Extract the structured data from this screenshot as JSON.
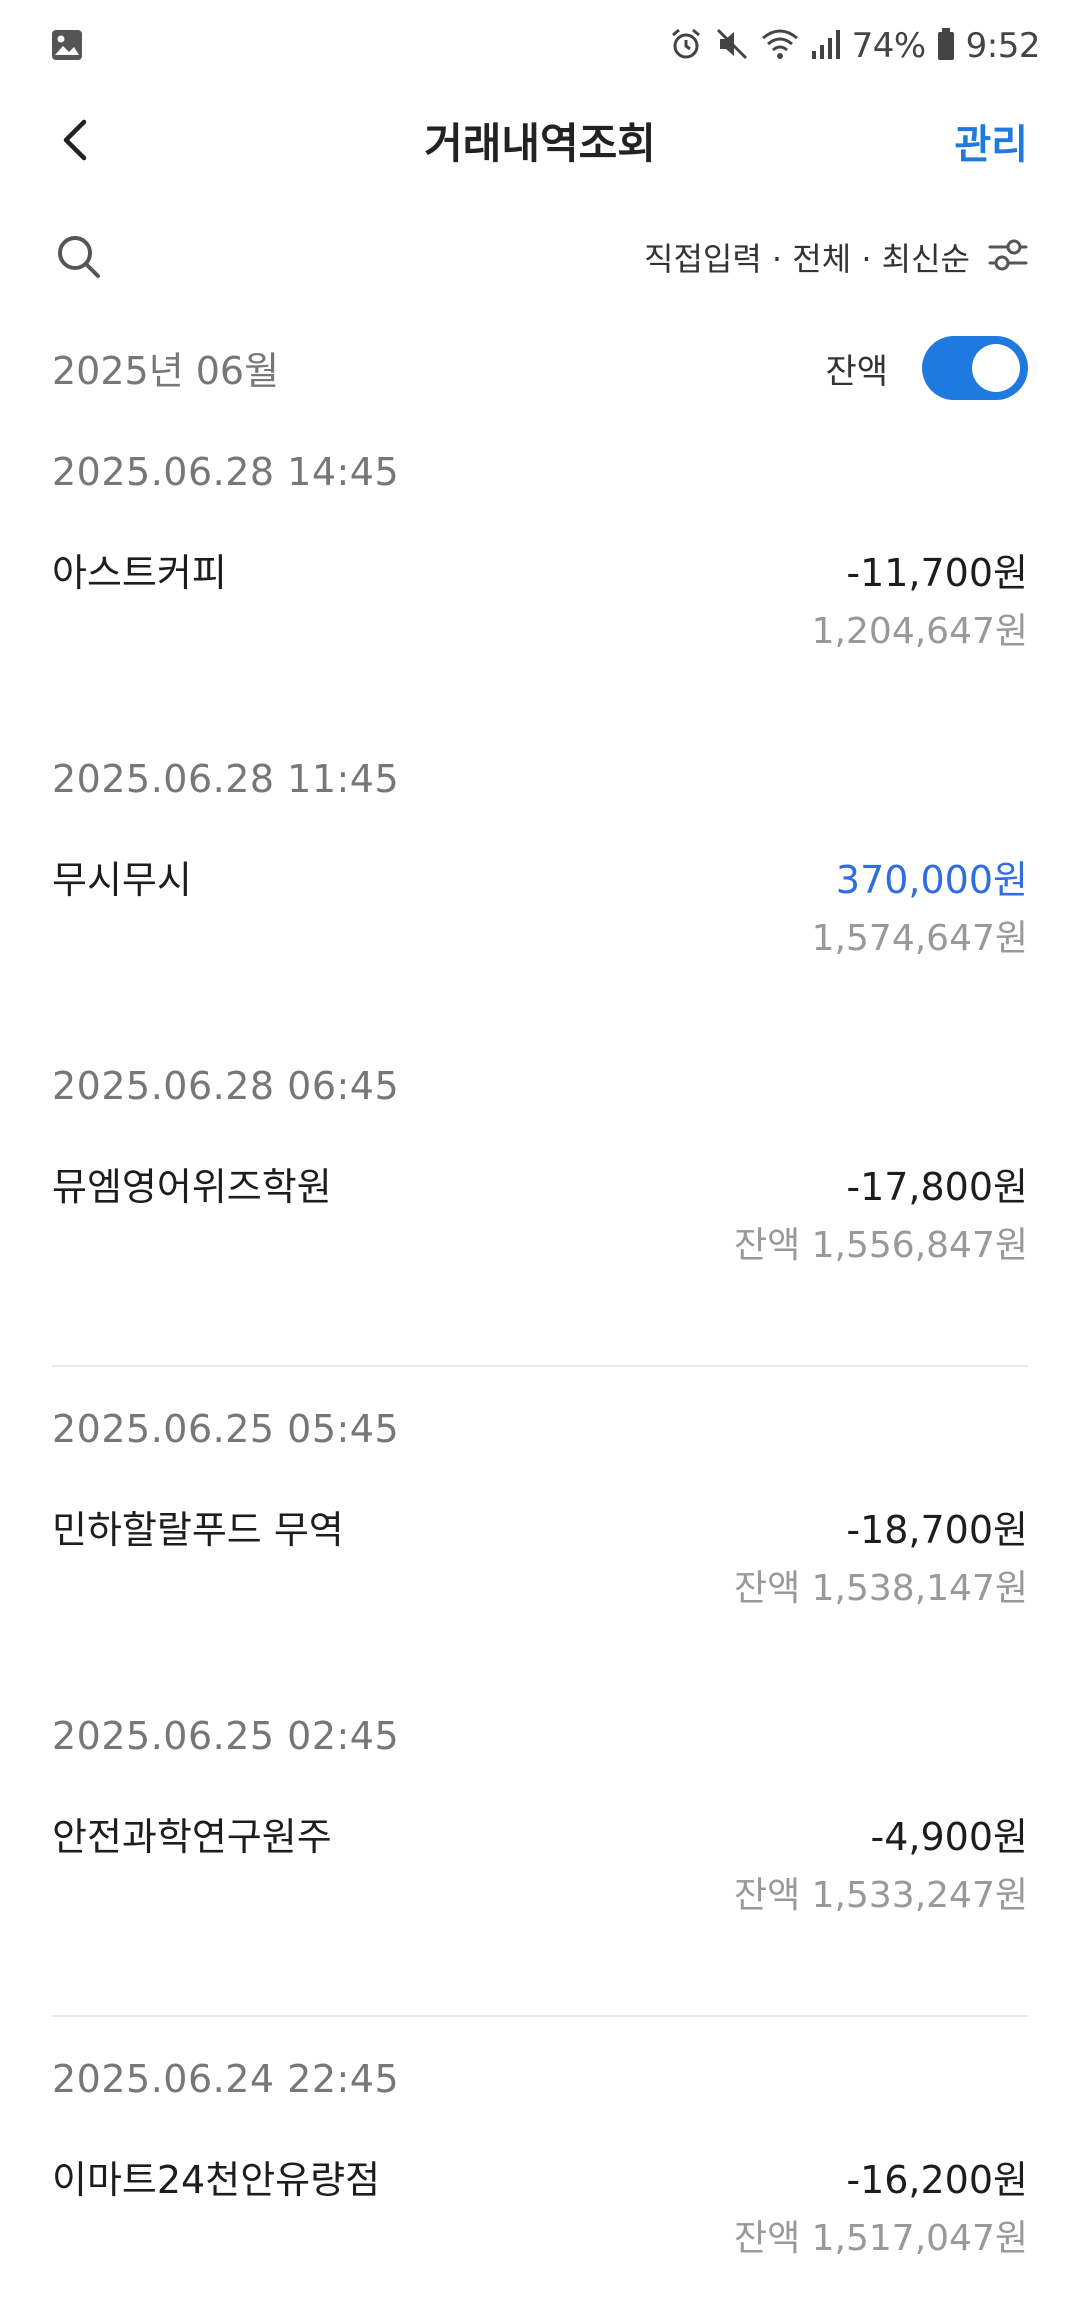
{
  "status_bar": {
    "battery": "74%",
    "time": "9:52"
  },
  "header": {
    "title": "거래내역조회",
    "manage": "관리"
  },
  "filter": {
    "summary": "직접입력 · 전체 · 최신순"
  },
  "month": {
    "label": "2025년 06월",
    "balance_toggle_label": "잔액",
    "balance_toggle_on": true
  },
  "transactions": [
    {
      "datetime": "2025.06.28   14:45",
      "merchant": "아스트커피",
      "amount": "-11,700원",
      "balance": "1,204,647원",
      "positive": false
    },
    {
      "datetime": "2025.06.28   11:45",
      "merchant": "무시무시",
      "amount": "370,000원",
      "balance": "1,574,647원",
      "positive": true
    },
    {
      "datetime": "2025.06.28   06:45",
      "merchant": "뮤엠영어위즈학원",
      "amount": "-17,800원",
      "balance": "잔액 1,556,847원",
      "positive": false
    },
    {
      "datetime": "2025.06.25   05:45",
      "merchant": "민하할랄푸드 무역",
      "amount": "-18,700원",
      "balance": "잔액 1,538,147원",
      "positive": false
    },
    {
      "datetime": "2025.06.25   02:45",
      "merchant": "안전과학연구원주",
      "amount": "-4,900원",
      "balance": "잔액 1,533,247원",
      "positive": false
    },
    {
      "datetime": "2025.06.24   22:45",
      "merchant": "이마트24천안유량점",
      "amount": "-16,200원",
      "balance": "잔액 1,517,047원",
      "positive": false
    }
  ],
  "colors": {
    "accent": "#1f7ae0",
    "positive_amount": "#2f6ee0",
    "secondary_text": "#999999"
  },
  "icons": {
    "status_left": "gallery-icon",
    "alarm": "alarm-icon",
    "mute": "mute-icon",
    "wifi": "wifi-icon",
    "signal": "signal-icon",
    "battery": "battery-icon",
    "back": "chevron-left-icon",
    "search": "search-icon",
    "filter": "filter-sliders-icon"
  }
}
